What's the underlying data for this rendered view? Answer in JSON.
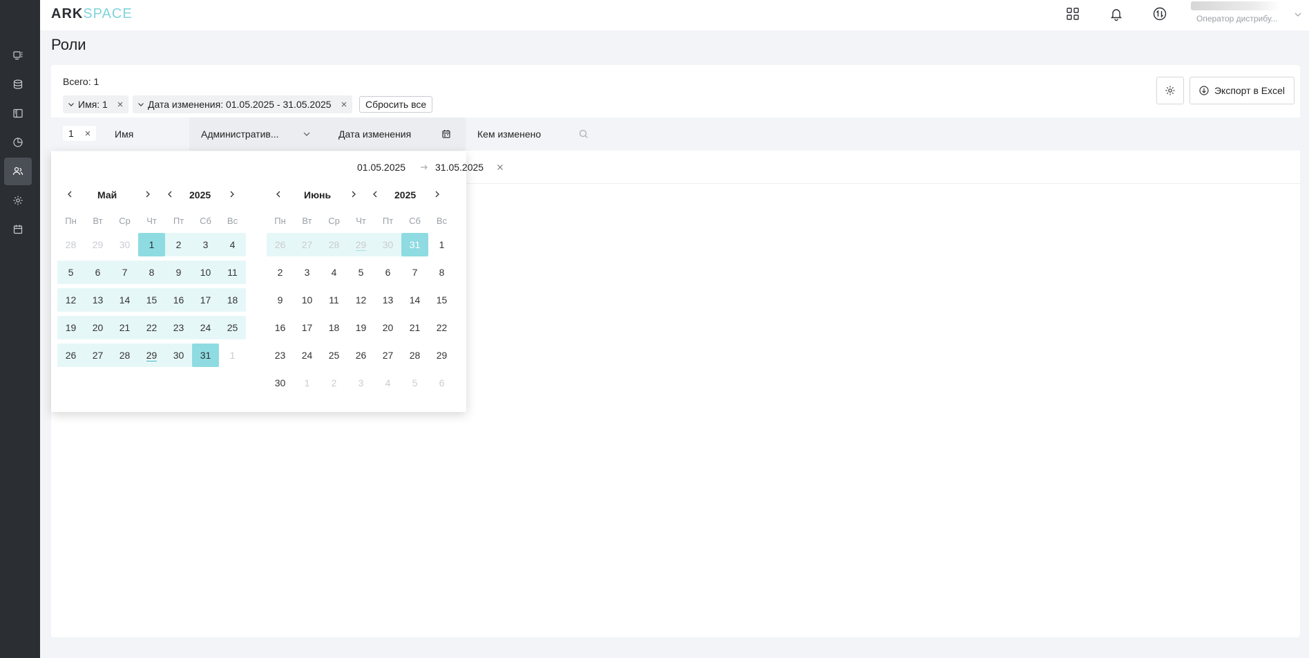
{
  "header": {
    "logo_ark": "ARK",
    "logo_space": "SPACE",
    "user_role": "Оператор дистрибу..."
  },
  "page": {
    "title": "Роли"
  },
  "toolbar": {
    "total": "Всего: 1",
    "filters": [
      {
        "label": "Имя: 1"
      },
      {
        "label": "Дата изменения: 01.05.2025 - 31.05.2025"
      }
    ],
    "reset_label": "Сбросить все",
    "export_label": "Экспорт в Excel"
  },
  "table": {
    "id_filter_value": "1",
    "columns": [
      "Имя",
      "Административ...",
      "Дата изменения",
      "Кем изменено"
    ]
  },
  "datepicker": {
    "start": "01.05.2025",
    "end": "31.05.2025",
    "weekdays": [
      "Пн",
      "Вт",
      "Ср",
      "Чт",
      "Пт",
      "Сб",
      "Вс"
    ],
    "months": [
      {
        "month": "Май",
        "year": "2025",
        "weeks": [
          [
            "28",
            "29",
            "30",
            "1",
            "2",
            "3",
            "4"
          ],
          [
            "5",
            "6",
            "7",
            "8",
            "9",
            "10",
            "11"
          ],
          [
            "12",
            "13",
            "14",
            "15",
            "16",
            "17",
            "18"
          ],
          [
            "19",
            "20",
            "21",
            "22",
            "23",
            "24",
            "25"
          ],
          [
            "26",
            "27",
            "28",
            "29",
            "30",
            "31",
            "1"
          ]
        ]
      },
      {
        "month": "Июнь",
        "year": "2025",
        "weeks": [
          [
            "26",
            "27",
            "28",
            "29",
            "30",
            "31",
            "1"
          ],
          [
            "2",
            "3",
            "4",
            "5",
            "6",
            "7",
            "8"
          ],
          [
            "9",
            "10",
            "11",
            "12",
            "13",
            "14",
            "15"
          ],
          [
            "16",
            "17",
            "18",
            "19",
            "20",
            "21",
            "22"
          ],
          [
            "23",
            "24",
            "25",
            "26",
            "27",
            "28",
            "29"
          ],
          [
            "30",
            "1",
            "2",
            "3",
            "4",
            "5",
            "6"
          ]
        ]
      }
    ]
  },
  "colors": {
    "accent": "#8fdbe2",
    "range": "#e6f7f8",
    "sidebar": "#2b2e33"
  }
}
